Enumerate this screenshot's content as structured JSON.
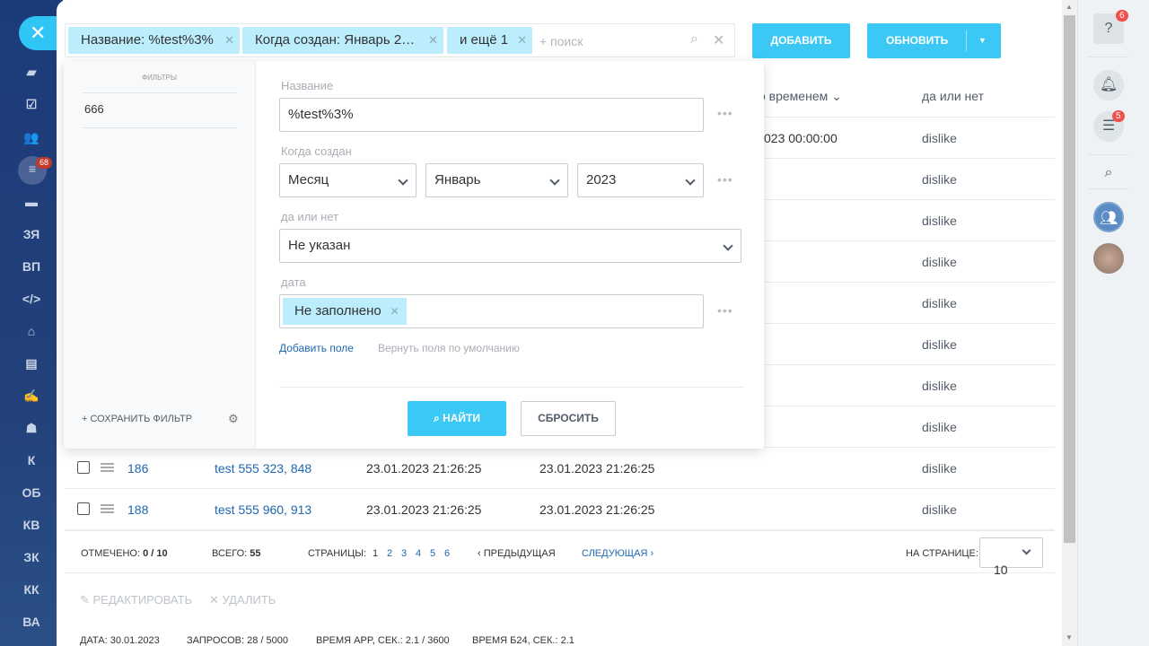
{
  "sidebar": {
    "close": "✕",
    "badge": "68",
    "items": [
      "ЗЯ",
      "ВП",
      "К",
      "ОБ",
      "КВ",
      "ЗК",
      "КК",
      "ВА"
    ]
  },
  "filter_bar": {
    "chips": [
      "Название: %test%3%",
      "Когда создан: Январь 2…",
      "и ещё 1"
    ],
    "placeholder": "+ поиск"
  },
  "toolbar": {
    "add": "ДОБАВИТЬ",
    "refresh": "ОБНОВИТЬ"
  },
  "right_bar": {
    "help_badge": "6",
    "chat_badge": "5"
  },
  "table": {
    "headers": {
      "time": "о временем",
      "yesno": "да или нет"
    },
    "rows": [
      {
        "id": "",
        "name": "",
        "created": "",
        "modified": "023 00:00:00",
        "yesno": "dislike"
      },
      {
        "id": "",
        "name": "",
        "created": "",
        "modified": "",
        "yesno": "dislike"
      },
      {
        "id": "",
        "name": "",
        "created": "",
        "modified": "",
        "yesno": "dislike"
      },
      {
        "id": "",
        "name": "",
        "created": "",
        "modified": "",
        "yesno": "dislike"
      },
      {
        "id": "",
        "name": "",
        "created": "",
        "modified": "",
        "yesno": "dislike"
      },
      {
        "id": "",
        "name": "",
        "created": "",
        "modified": "",
        "yesno": "dislike"
      },
      {
        "id": "",
        "name": "",
        "created": "",
        "modified": "",
        "yesno": "dislike"
      },
      {
        "id": "",
        "name": "",
        "created": "",
        "modified": "",
        "yesno": "dislike"
      },
      {
        "id": "186",
        "name": "test 555 323, 848",
        "created": "23.01.2023 21:26:25",
        "modified": "23.01.2023 21:26:25",
        "yesno": "dislike"
      },
      {
        "id": "188",
        "name": "test 555 960, 913",
        "created": "23.01.2023 21:26:25",
        "modified": "23.01.2023 21:26:25",
        "yesno": "dislike"
      }
    ]
  },
  "footer": {
    "checked_label": "ОТМЕЧЕНО:",
    "checked": "0 / 10",
    "total_label": "ВСЕГО:",
    "total": "55",
    "pages_label": "СТРАНИЦЫ:",
    "pages": [
      "1",
      "2",
      "3",
      "4",
      "5",
      "6"
    ],
    "prev": "‹ ПРЕДЫДУЩАЯ",
    "next": "СЛЕДУЮЩАЯ ›",
    "per_page_label": "НА СТРАНИЦЕ:",
    "per_page": "10"
  },
  "actions": {
    "edit": "✎ РЕДАКТИРОВАТЬ",
    "delete": "✕ УДАЛИТЬ"
  },
  "status": {
    "date": "ДАТА: 30.01.2023",
    "requests": "ЗАПРОСОВ: 28 / 5000",
    "app_time": "ВРЕМЯ APP, СЕК.: 2.1 / 3600",
    "b24_time": "ВРЕМЯ Б24, СЕК.: 2.1"
  },
  "popup": {
    "filters_title": "ФИЛЬТРЫ",
    "saved": [
      "666"
    ],
    "save_filter": "+ СОХРАНИТЬ ФИЛЬТР",
    "name_label": "Название",
    "name_value": "%test%3%",
    "created_label": "Когда создан",
    "period": "Месяц",
    "month": "Январь",
    "year": "2023",
    "yesno_label": "да или нет",
    "yesno_value": "Не указан",
    "date_label": "дата",
    "date_chip": "Не заполнено",
    "add_field": "Добавить поле",
    "reset_fields": "Вернуть поля по умолчанию",
    "find": "НАЙТИ",
    "reset": "СБРОСИТЬ"
  }
}
